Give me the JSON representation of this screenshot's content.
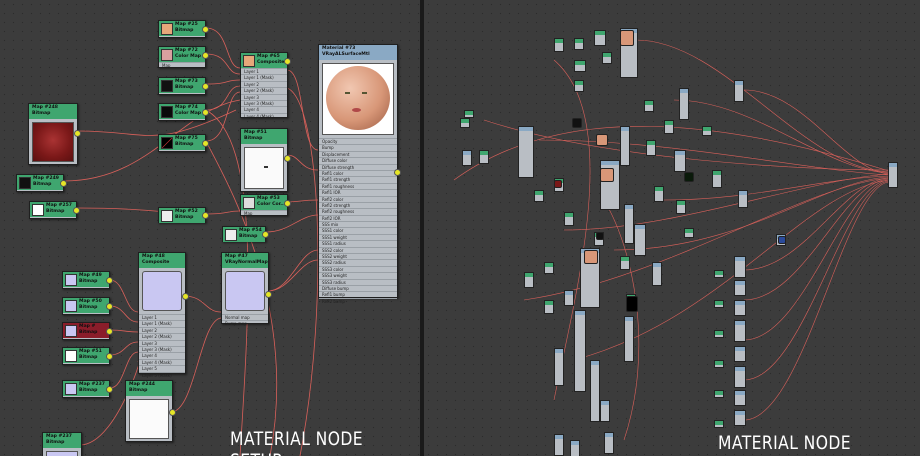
{
  "left_panel": {
    "caption": "MATERIAL NODE SETUP",
    "nodes": {
      "map25": {
        "id": "Map #25",
        "type": "Bitmap"
      },
      "map72": {
        "id": "Map #72",
        "type": "Color Map",
        "sub": "Map"
      },
      "map73": {
        "id": "Map #73",
        "type": "Bitmap"
      },
      "map74": {
        "id": "Map #74",
        "type": "Color Map"
      },
      "map75": {
        "id": "Map #75",
        "type": "Bitmap"
      },
      "map65": {
        "id": "Map #65",
        "type": "Composite",
        "slots": [
          "Layer 1",
          "Layer 1 (Mask)",
          "Layer 2",
          "Layer 2 (Mask)",
          "Layer 3",
          "Layer 3 (Mask)",
          "Layer 4",
          "Layer 4 (Mask)"
        ]
      },
      "map248": {
        "id": "Map #248",
        "type": "Bitmap"
      },
      "map249": {
        "id": "Map #249",
        "type": "Bitmap"
      },
      "map257": {
        "id": "Map #257",
        "type": "Bitmap"
      },
      "map51": {
        "id": "Map #51",
        "type": "Bitmap"
      },
      "map52": {
        "id": "Map #52",
        "type": "Bitmap"
      },
      "map53": {
        "id": "Map #53",
        "type": "Color Cor...",
        "sub": "Map"
      },
      "map54": {
        "id": "Map #54",
        "type": "Bitmap"
      },
      "material": {
        "id": "Material #73",
        "type": "VRayALSurfaceMtl",
        "slots": [
          "Opacity",
          "Bump",
          "Displacement",
          "Diffuse color",
          "Diffuse strength",
          "Refl1 color",
          "Refl1 strength",
          "Refl1 roughness",
          "Refl1 IOR",
          "Refl2 color",
          "Refl2 strength",
          "Refl2 roughness",
          "Refl2 IOR",
          "SSS mix",
          "SSS1 color",
          "SSS1 weight",
          "SSS1 radius",
          "SSS2 color",
          "SSS2 weight",
          "SSS2 radius",
          "SSS3 color",
          "SSS3 weight",
          "SSS3 radius",
          "Diffuse bump",
          "Refl1 bump",
          "Refl2 bump"
        ]
      },
      "map48": {
        "id": "Map #48",
        "type": "Composite",
        "slots": [
          "Layer 1",
          "Layer 1 (Mask)",
          "Layer 2",
          "Layer 2 (Mask)",
          "Layer 3",
          "Layer 3 (Mask)",
          "Layer 4",
          "Layer 4 (Mask)",
          "Layer 5",
          "Layer 5 (Mask)"
        ]
      },
      "map47": {
        "id": "Map #47",
        "type": "VRayNormalMap",
        "slots": [
          "Normal map",
          "Bump map"
        ]
      },
      "map49": {
        "id": "Map #49",
        "type": "Bitmap"
      },
      "map50": {
        "id": "Map #50",
        "type": "Bitmap"
      },
      "map31": {
        "id": "Map #51",
        "type": "Bitmap"
      },
      "map_red": {
        "id": "Map #",
        "type": "Bitmap"
      },
      "map237": {
        "id": "Map #237",
        "type": "Bitmap"
      },
      "map244": {
        "id": "Map #244",
        "type": "Bitmap"
      },
      "map237b": {
        "id": "Map #237",
        "type": "Bitmap"
      }
    }
  },
  "right_panel": {
    "caption": "MATERIAL NODE SETUP"
  },
  "colors": {
    "background": "#3c3c3c",
    "node_header": "#3fa66f",
    "material_header": "#8aa9c4",
    "node_body": "#b9bec4",
    "wire": "#d9605a",
    "port": "#e6e627"
  }
}
